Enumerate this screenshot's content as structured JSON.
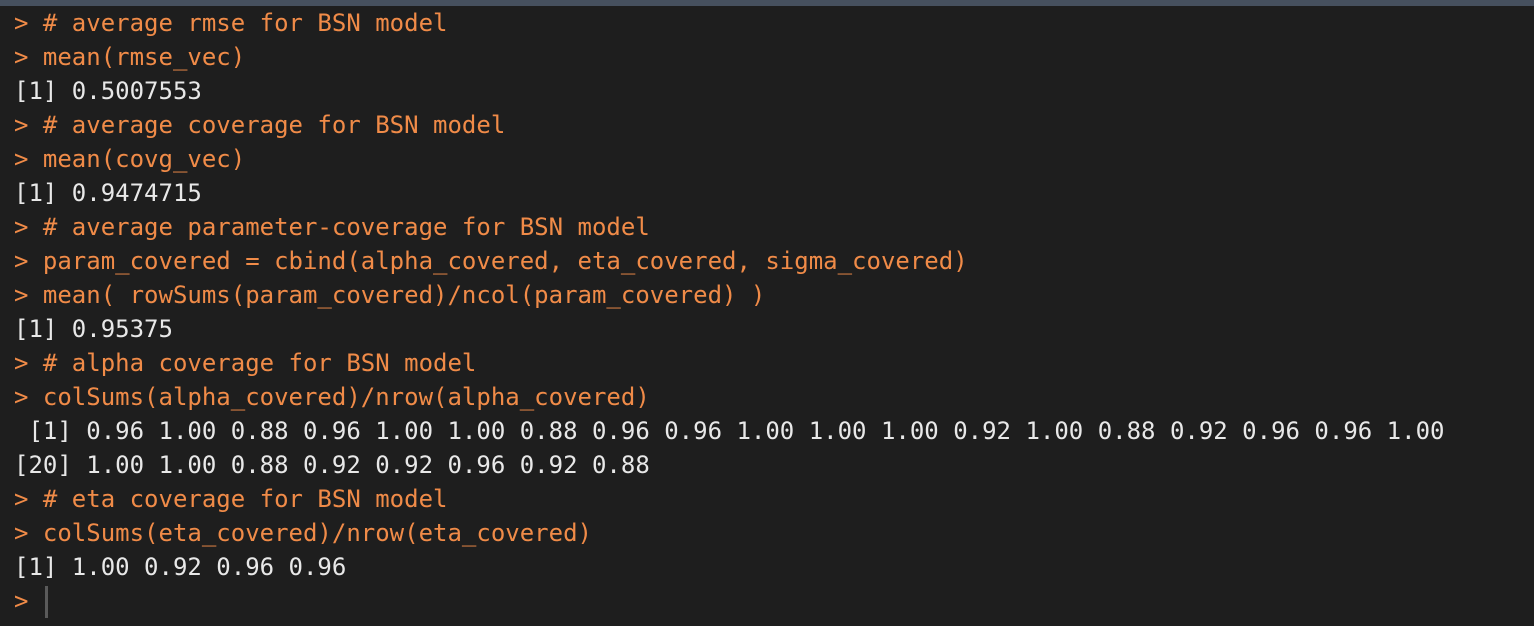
{
  "console": {
    "lines": [
      {
        "type": "input",
        "text": "> # average rmse for BSN model"
      },
      {
        "type": "input",
        "text": "> mean(rmse_vec)"
      },
      {
        "type": "output",
        "text": "[1] 0.5007553"
      },
      {
        "type": "input",
        "text": "> # average coverage for BSN model"
      },
      {
        "type": "input",
        "text": "> mean(covg_vec)"
      },
      {
        "type": "output",
        "text": "[1] 0.9474715"
      },
      {
        "type": "input",
        "text": "> # average parameter-coverage for BSN model"
      },
      {
        "type": "input",
        "text": "> param_covered = cbind(alpha_covered, eta_covered, sigma_covered)"
      },
      {
        "type": "input",
        "text": "> mean( rowSums(param_covered)/ncol(param_covered) )"
      },
      {
        "type": "output",
        "text": "[1] 0.95375"
      },
      {
        "type": "input",
        "text": "> # alpha coverage for BSN model"
      },
      {
        "type": "input",
        "text": "> colSums(alpha_covered)/nrow(alpha_covered)"
      },
      {
        "type": "output",
        "text": " [1] 0.96 1.00 0.88 0.96 1.00 1.00 0.88 0.96 0.96 1.00 1.00 1.00 0.92 1.00 0.88 0.92 0.96 0.96 1.00"
      },
      {
        "type": "output",
        "text": "[20] 1.00 1.00 0.88 0.92 0.92 0.96 0.92 0.88"
      },
      {
        "type": "input",
        "text": "> # eta coverage for BSN model"
      },
      {
        "type": "input",
        "text": "> colSums(eta_covered)/nrow(eta_covered)"
      },
      {
        "type": "output",
        "text": "[1] 1.00 0.92 0.96 0.96"
      }
    ],
    "prompt": ">"
  },
  "colors": {
    "background": "#1e1e1e",
    "input_text": "#f08b48",
    "output_text": "#e8e8e8"
  }
}
